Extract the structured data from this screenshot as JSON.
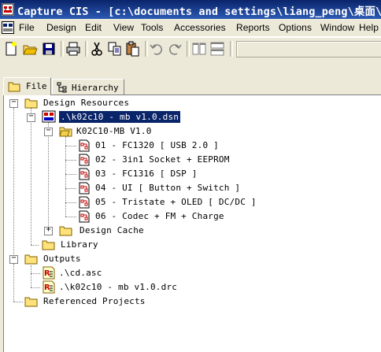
{
  "window": {
    "title": "Capture CIS - [c:\\documents and settings\\liang_peng\\桌面\\tr",
    "colors": {
      "titlebar": "#0a246a",
      "selection": "#0a246a",
      "chrome": "#ece9d8"
    }
  },
  "menu": {
    "items": [
      {
        "label": "File",
        "name": "menu-file"
      },
      {
        "label": "Design",
        "name": "menu-design"
      },
      {
        "label": "Edit",
        "name": "menu-edit"
      },
      {
        "label": "View",
        "name": "menu-view"
      },
      {
        "label": "Tools",
        "name": "menu-tools"
      },
      {
        "label": "Accessories",
        "name": "menu-accessories"
      },
      {
        "label": "Reports",
        "name": "menu-reports"
      },
      {
        "label": "Options",
        "name": "menu-options"
      },
      {
        "label": "Window",
        "name": "menu-window"
      },
      {
        "label": "Help",
        "name": "menu-help"
      }
    ]
  },
  "toolbar": {
    "buttons": [
      "new-icon",
      "open-folder-icon",
      "save-icon",
      "print-icon",
      "cut-icon",
      "copy-icon",
      "paste-icon",
      "undo-icon",
      "redo-icon",
      "tile-vertical-icon",
      "tile-horizontal-icon"
    ],
    "combo_value": ""
  },
  "tabs": {
    "file_label": "File",
    "hierarchy_label": "Hierarchy",
    "active": "File"
  },
  "tree": {
    "root_label": "Design Resources",
    "design_file": ".\\k02c10 - mb v1.0.dsn",
    "schematic_folder": "K02C10-MB V1.0",
    "pages": [
      "01 - FC1320 [ USB 2.0 ]",
      "02 - 3in1 Socket + EEPROM",
      "03 - FC1316 [ DSP ]",
      "04 - UI [ Button + Switch ]",
      "05 - Tristate + OLED [ DC/DC ]",
      "06 - Codec + FM + Charge"
    ],
    "design_cache": "Design Cache",
    "library": "Library",
    "outputs_label": "Outputs",
    "outputs": [
      ".\\cd.asc",
      ".\\k02c10 - mb v1.0.drc"
    ],
    "referenced_projects": "Referenced Projects"
  }
}
